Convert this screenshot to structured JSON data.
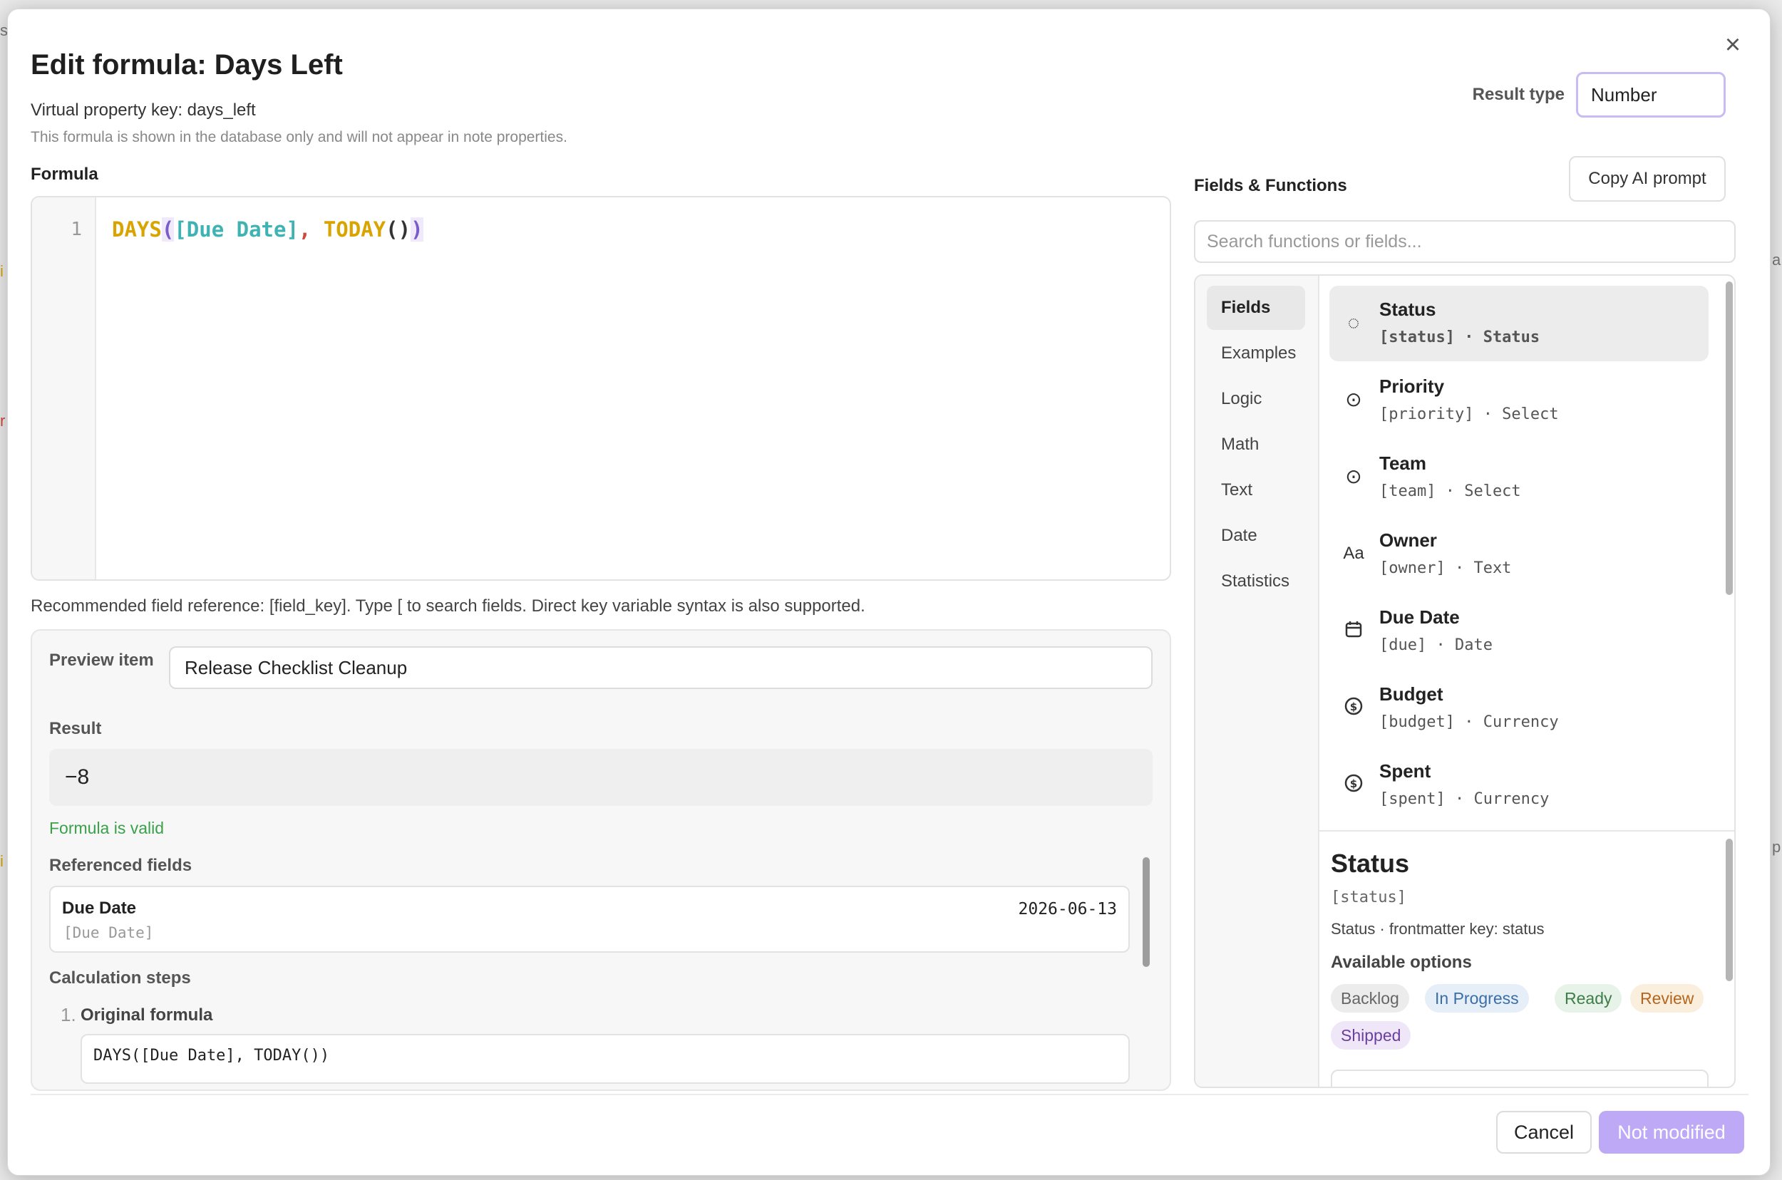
{
  "dialog": {
    "title": "Edit formula: Days Left",
    "subtitle": "Virtual property key: days_left",
    "note": "This formula is shown in the database only and will not appear in note properties.",
    "close_icon": "close-icon",
    "result_type_label": "Result type",
    "result_type_value": "Number"
  },
  "editor": {
    "label": "Formula",
    "line_number": "1",
    "tokens": {
      "fn1": "DAYS",
      "open1": "(",
      "field": "[Due Date]",
      "comma": ", ",
      "fn2": "TODAY",
      "parens2": "()",
      "close1": ")"
    },
    "hint": "Recommended field reference: [field_key]. Type [ to search fields. Direct key variable syntax is also supported."
  },
  "preview": {
    "item_label": "Preview item",
    "item_value": "Release Checklist Cleanup",
    "result_label": "Result",
    "result_value": "−8",
    "valid_text": "Formula is valid",
    "referenced_label": "Referenced fields",
    "referenced": [
      {
        "name": "Due Date",
        "key": "[Due Date]",
        "value": "2026-06-13"
      }
    ],
    "steps_label": "Calculation steps",
    "steps": [
      {
        "num": "1.",
        "title": "Original formula",
        "code": "DAYS([Due Date], TODAY())"
      }
    ]
  },
  "fields_functions": {
    "title": "Fields & Functions",
    "copy_button": "Copy AI prompt",
    "search_placeholder": "Search functions or fields...",
    "categories": [
      "Fields",
      "Examples",
      "Logic",
      "Math",
      "Text",
      "Date",
      "Statistics"
    ],
    "active_category": "Fields",
    "fields": [
      {
        "name": "Status",
        "meta": "[status] · Status",
        "icon": "status-icon"
      },
      {
        "name": "Priority",
        "meta": "[priority] · Select",
        "icon": "select-icon"
      },
      {
        "name": "Team",
        "meta": "[team] · Select",
        "icon": "select-icon"
      },
      {
        "name": "Owner",
        "meta": "[owner] · Text",
        "icon": "text-icon"
      },
      {
        "name": "Due Date",
        "meta": "[due] · Date",
        "icon": "calendar-icon"
      },
      {
        "name": "Budget",
        "meta": "[budget] · Currency",
        "icon": "currency-icon"
      },
      {
        "name": "Spent",
        "meta": "[spent] · Currency",
        "icon": "currency-icon"
      }
    ],
    "detail": {
      "title": "Status",
      "key": "[status]",
      "description": "Status · frontmatter key: status",
      "options_label": "Available options",
      "options": [
        "Backlog",
        "In Progress",
        "Ready",
        "Review",
        "Shipped"
      ]
    }
  },
  "footer": {
    "cancel": "Cancel",
    "save": "Not modified"
  },
  "colors": {
    "accent": "#bda9f5",
    "valid": "#3aa04a",
    "fn_token": "#d9a400",
    "field_token": "#3fb3b3",
    "comma_token": "#d0473b"
  }
}
